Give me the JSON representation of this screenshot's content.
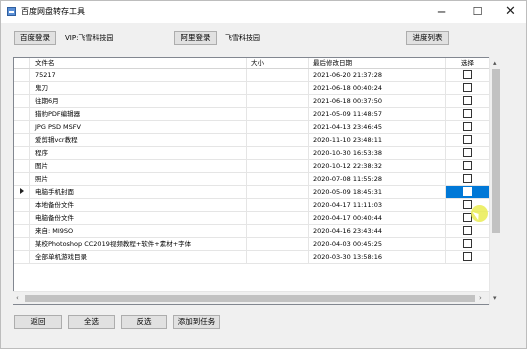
{
  "window": {
    "title": "百度网盘转存工具"
  },
  "controls": {
    "minimize": "─",
    "maximize": "☐",
    "close": "✕"
  },
  "top": {
    "baidu_login": "百度登录",
    "vip_label": "VIP:飞雪科技园",
    "aliyun_login": "阿里登录",
    "aliyun_user": "飞雪科技园",
    "progress_list": "进度列表"
  },
  "table": {
    "headers": {
      "name": "文件名",
      "size": "大小",
      "date": "最后修改日期",
      "select": "选择"
    },
    "rows": [
      {
        "name": "75217",
        "size": "",
        "date": "2021-06-20 21:37:28"
      },
      {
        "name": "鬼刀",
        "size": "",
        "date": "2021-06-18 00:40:24"
      },
      {
        "name": "往期6月",
        "size": "",
        "date": "2021-06-18 00:37:50"
      },
      {
        "name": "猎豹PDF编辑器",
        "size": "",
        "date": "2021-05-09 11:48:57"
      },
      {
        "name": "JPG PSD MSFV",
        "size": "",
        "date": "2021-04-13 23:46:45"
      },
      {
        "name": "爱剪辑vcr教程",
        "size": "",
        "date": "2020-11-10 23:48:11"
      },
      {
        "name": "程序",
        "size": "",
        "date": "2020-10-30 16:53:38"
      },
      {
        "name": "图片",
        "size": "",
        "date": "2020-10-12 22:38:32"
      },
      {
        "name": "照片",
        "size": "",
        "date": "2020-07-08 11:55:28"
      },
      {
        "name": "电脑手机封面",
        "size": "",
        "date": "2020-05-09 18:45:31"
      },
      {
        "name": "本地备份文件",
        "size": "",
        "date": "2020-04-17 11:11:03"
      },
      {
        "name": "电脑备份文件",
        "size": "",
        "date": "2020-04-17 00:40:44"
      },
      {
        "name": "来自: MI9SO",
        "size": "",
        "date": "2020-04-16 23:43:44"
      },
      {
        "name": "某校Photoshop CC2019视频教程+软件+素材+字体",
        "size": "",
        "date": "2020-04-03 00:45:25"
      },
      {
        "name": "全部单机游戏目录",
        "size": "",
        "date": "2020-03-30 13:58:16"
      }
    ],
    "current_row_index": 9,
    "selected_cell_row": 9,
    "checked": [
      false,
      false,
      false,
      false,
      false,
      false,
      false,
      false,
      false,
      false,
      false,
      false,
      false,
      false,
      false
    ]
  },
  "bottom": {
    "back": "返回",
    "select_all": "全选",
    "invert": "反选",
    "add_task": "添加到任务"
  }
}
